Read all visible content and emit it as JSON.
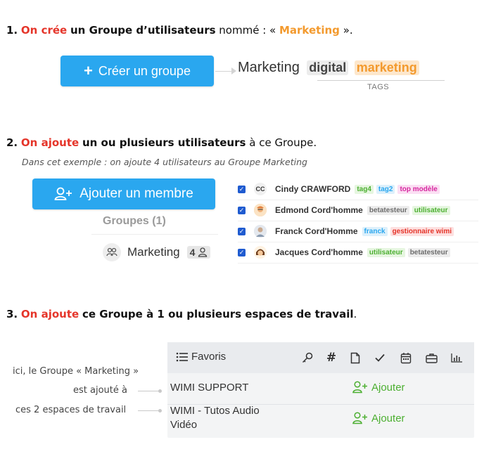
{
  "step1": {
    "number": "1.",
    "verb": "On crée",
    "text_a": "un Groupe d’utilisateurs",
    "text_b": "nommé : «",
    "group_name": "Marketing",
    "text_c": "»."
  },
  "create_group_button": {
    "label": "Créer un groupe"
  },
  "tags_example": {
    "title": "Marketing",
    "tag1": "digital",
    "tag2": "marketing",
    "caption": "TAGS"
  },
  "step2": {
    "number": "2.",
    "verb": "On ajoute",
    "text_a": "un ou plusieurs utilisateurs",
    "text_b": "à ce Groupe.",
    "note": "Dans cet exemple : on ajoute 4 utilisateurs au Groupe Marketing"
  },
  "add_member_button": {
    "label": "Ajouter un membre"
  },
  "groups_panel": {
    "heading": "Groupes (1)",
    "group_name": "Marketing",
    "member_count": "4"
  },
  "users": [
    {
      "name": "Cindy CRAWFORD",
      "initials": "CC",
      "tags": [
        {
          "label": "tag4",
          "color": "green"
        },
        {
          "label": "tag2",
          "color": "blue"
        },
        {
          "label": "top modèle",
          "color": "pink"
        }
      ]
    },
    {
      "name": "Edmond Cord'homme",
      "initials": "",
      "tags": [
        {
          "label": "betatesteur",
          "color": "gray"
        },
        {
          "label": "utilisateur",
          "color": "green"
        }
      ]
    },
    {
      "name": "Franck Cord'Homme",
      "initials": "",
      "tags": [
        {
          "label": "franck",
          "color": "blue"
        },
        {
          "label": "gestionnaire wimi",
          "color": "red"
        }
      ]
    },
    {
      "name": "Jacques Cord'homme",
      "initials": "",
      "tags": [
        {
          "label": "utilisateur",
          "color": "green"
        },
        {
          "label": "betatesteur",
          "color": "gray"
        }
      ]
    }
  ],
  "step3": {
    "number": "3.",
    "verb": "On ajoute",
    "text_a": "ce Groupe à 1 ou plusieurs espaces de travail",
    "text_b": "."
  },
  "annotations": {
    "line1": "ici, le Groupe « Marketing »",
    "line2": "est ajouté à",
    "line3": "ces 2 espaces de travail"
  },
  "workspace_panel": {
    "header_label": "Favoris",
    "header_icons": [
      "key-icon",
      "hash-icon",
      "document-icon",
      "check-icon",
      "calendar-icon",
      "briefcase-icon",
      "bar-chart-icon"
    ],
    "rows": [
      {
        "name": "WIMI SUPPORT",
        "action": "Ajouter"
      },
      {
        "name_line1": "WIMI - Tutos Audio",
        "name_line2": "Vidéo",
        "action": "Ajouter"
      }
    ]
  },
  "colors": {
    "accent_blue": "#2aa7ef",
    "highlight_red": "#e5352a",
    "highlight_orange": "#f39a2e",
    "action_green": "#4caf31"
  }
}
